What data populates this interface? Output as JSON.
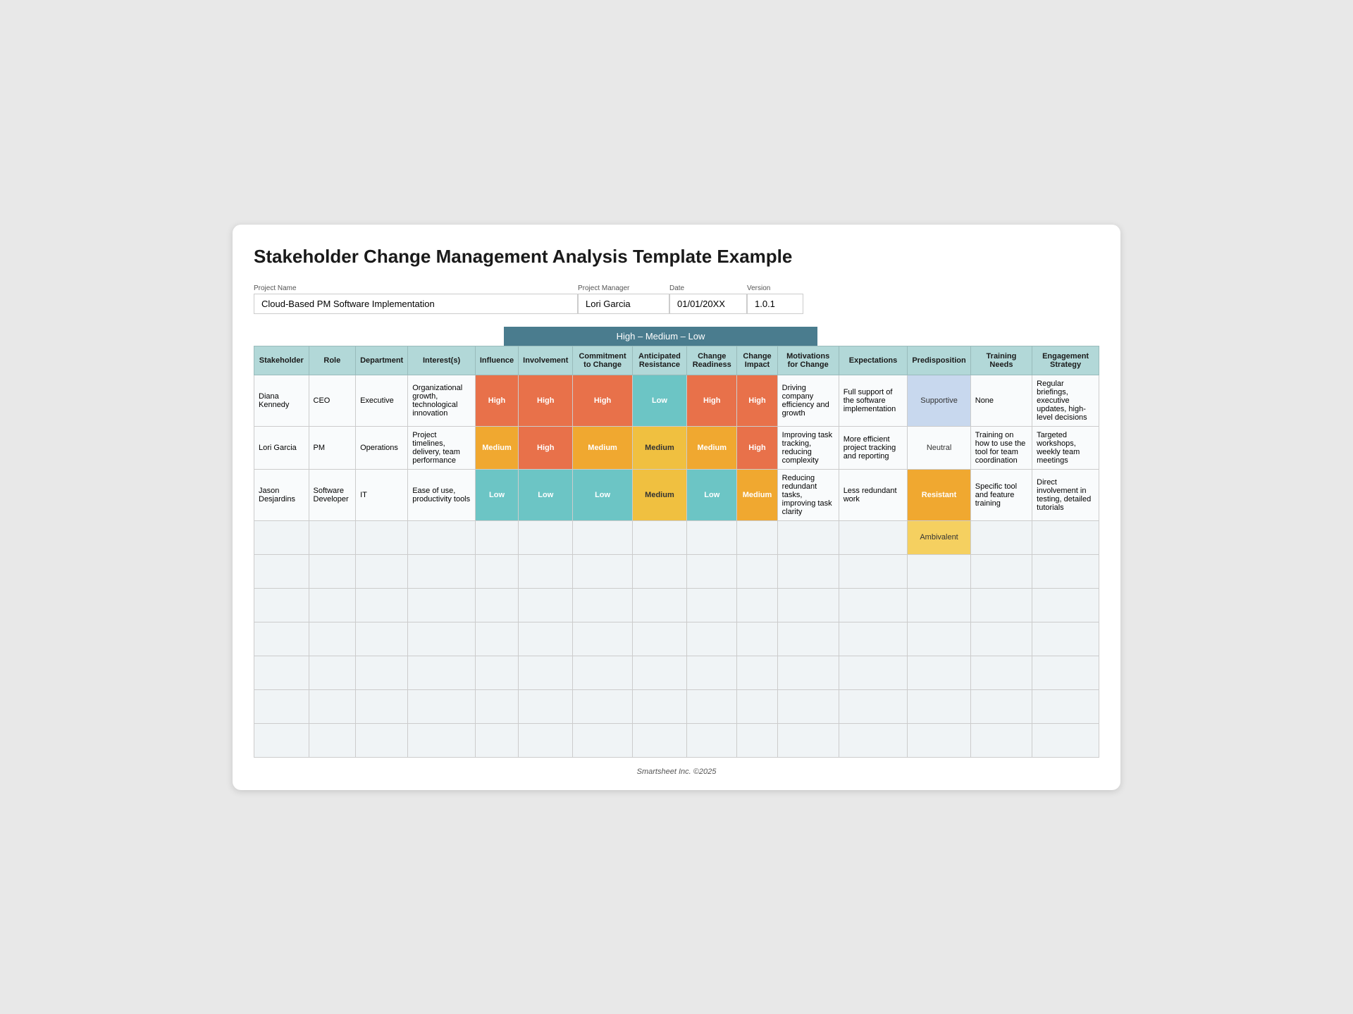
{
  "title": "Stakeholder Change Management Analysis Template Example",
  "projectInfo": {
    "nameLabel": "Project Name",
    "nameValue": "Cloud-Based PM Software Implementation",
    "managerLabel": "Project Manager",
    "managerValue": "Lori Garcia",
    "dateLabel": "Date",
    "dateValue": "01/01/20XX",
    "versionLabel": "Version",
    "versionValue": "1.0.1"
  },
  "legend": "High  –  Medium  –  Low",
  "columns": [
    "Stakeholder",
    "Role",
    "Department",
    "Interest(s)",
    "Influence",
    "Involvement",
    "Commitment to Change",
    "Anticipated Resistance",
    "Change Readiness",
    "Change Impact",
    "Motivations for Change",
    "Expectations",
    "Predisposition",
    "Training Needs",
    "Engagement Strategy"
  ],
  "rows": [
    {
      "stakeholder": "Diana Kennedy",
      "role": "CEO",
      "department": "Executive",
      "interests": "Organizational growth, technological innovation",
      "influence": "High",
      "involvement": "High",
      "commitmentToChange": "High",
      "anticipatedResistance": "Low",
      "changeReadiness": "High",
      "changeImpact": "High",
      "motivations": "Driving company efficiency and growth",
      "expectations": "Full support of the software implementation",
      "predisposition": "Supportive",
      "trainingNeeds": "None",
      "engagementStrategy": "Regular briefings, executive updates, high-level decisions"
    },
    {
      "stakeholder": "Lori Garcia",
      "role": "PM",
      "department": "Operations",
      "interests": "Project timelines, delivery, team performance",
      "influence": "Medium",
      "involvement": "High",
      "commitmentToChange": "Medium",
      "anticipatedResistance": "Medium",
      "changeReadiness": "Medium",
      "changeImpact": "High",
      "motivations": "Improving task tracking, reducing complexity",
      "expectations": "More efficient project tracking and reporting",
      "predisposition": "Neutral",
      "trainingNeeds": "Training on how to use the tool for team coordination",
      "engagementStrategy": "Targeted workshops, weekly team meetings"
    },
    {
      "stakeholder": "Jason Desjardins",
      "role": "Software Developer",
      "department": "IT",
      "interests": "Ease of use, productivity tools",
      "influence": "Low",
      "involvement": "Low",
      "commitmentToChange": "Low",
      "anticipatedResistance": "Medium",
      "changeReadiness": "Low",
      "changeImpact": "Medium",
      "motivations": "Reducing redundant tasks, improving task clarity",
      "expectations": "Less redundant work",
      "predisposition": "Resistant",
      "trainingNeeds": "Specific tool and feature training",
      "engagementStrategy": "Direct involvement in testing, detailed tutorials"
    }
  ],
  "emptyRows": [
    {
      "predisposition": "Ambivalent"
    },
    {},
    {},
    {},
    {},
    {},
    {}
  ],
  "footer": "Smartsheet Inc. ©2025"
}
